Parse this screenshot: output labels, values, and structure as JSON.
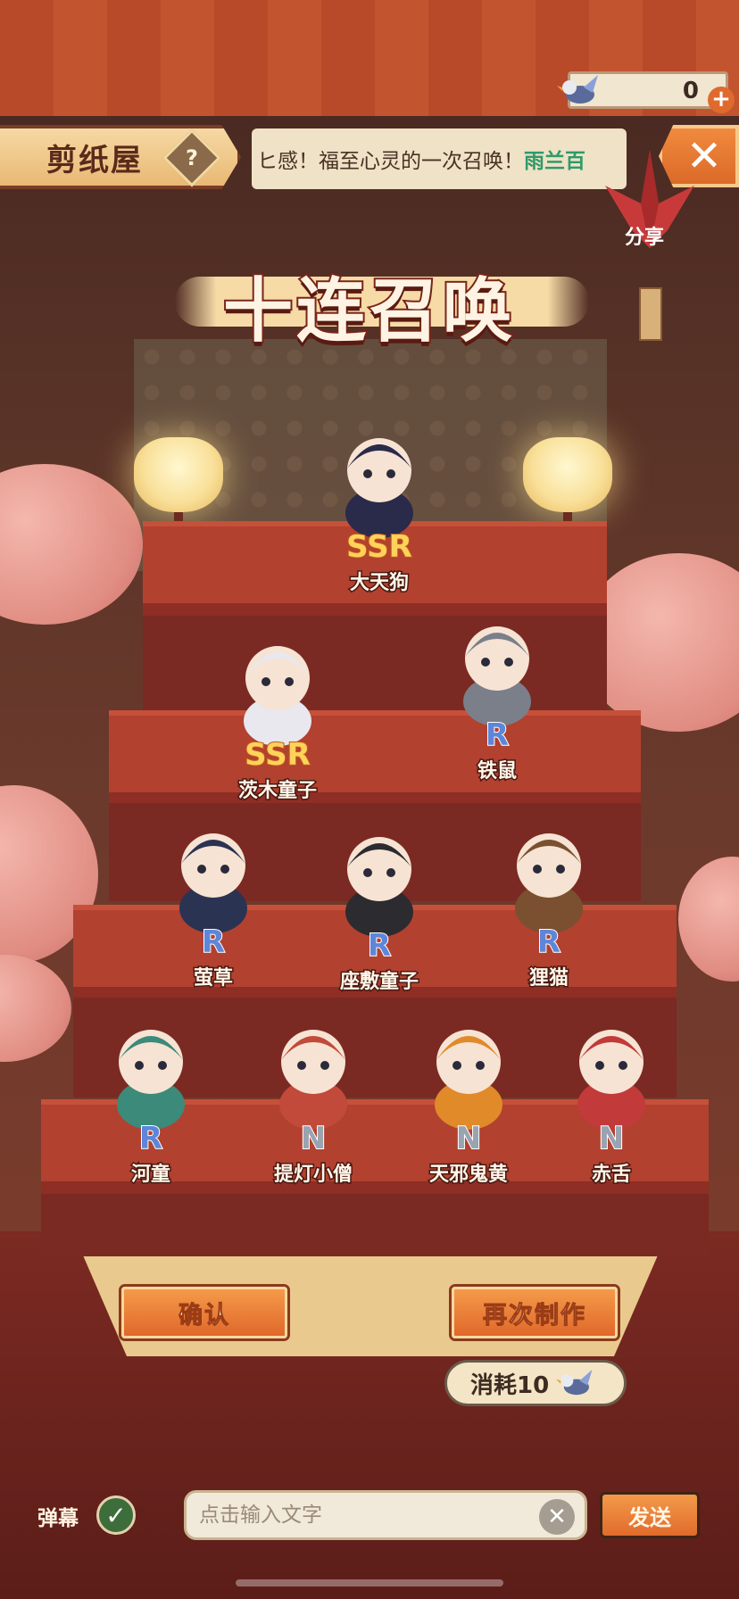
{
  "header": {
    "title": "剪纸屋",
    "help_icon": "question-mark-icon",
    "marquee_text": "ヒ感！福至心灵的一次召唤！",
    "marquee_user": "雨兰百",
    "close_icon": "close-x-icon",
    "currency_value": "0",
    "currency_plus": "+",
    "share_label": "分享"
  },
  "main": {
    "title": "十连召唤"
  },
  "characters": [
    {
      "rarity": "SSR",
      "name": "大天狗",
      "color": "#2a2a4a"
    },
    {
      "rarity": "SSR",
      "name": "茨木童子",
      "color": "#e8e8ee"
    },
    {
      "rarity": "R",
      "name": "铁鼠",
      "color": "#7a7f8a"
    },
    {
      "rarity": "R",
      "name": "萤草",
      "color": "#2b3352"
    },
    {
      "rarity": "R",
      "name": "座敷童子",
      "color": "#2b2b30"
    },
    {
      "rarity": "R",
      "name": "狸猫",
      "color": "#7a5030"
    },
    {
      "rarity": "R",
      "name": "河童",
      "color": "#3c8a7a"
    },
    {
      "rarity": "N",
      "name": "提灯小僧",
      "color": "#c24a3a"
    },
    {
      "rarity": "N",
      "name": "天邪鬼黄",
      "color": "#e08a2a"
    },
    {
      "rarity": "N",
      "name": "赤舌",
      "color": "#c23a3a"
    }
  ],
  "actions": {
    "confirm": "确认",
    "again": "再次制作",
    "cost": "消耗10"
  },
  "chat": {
    "danmu_label": "弹幕",
    "input_placeholder": "点击输入文字",
    "send": "发送"
  },
  "colors": {
    "accent_orange": "#e0682a",
    "marquee_user": "#2e9a6a",
    "ssr": "#ffd25b",
    "r": "#5e86d8",
    "n": "#9aa3b0"
  }
}
